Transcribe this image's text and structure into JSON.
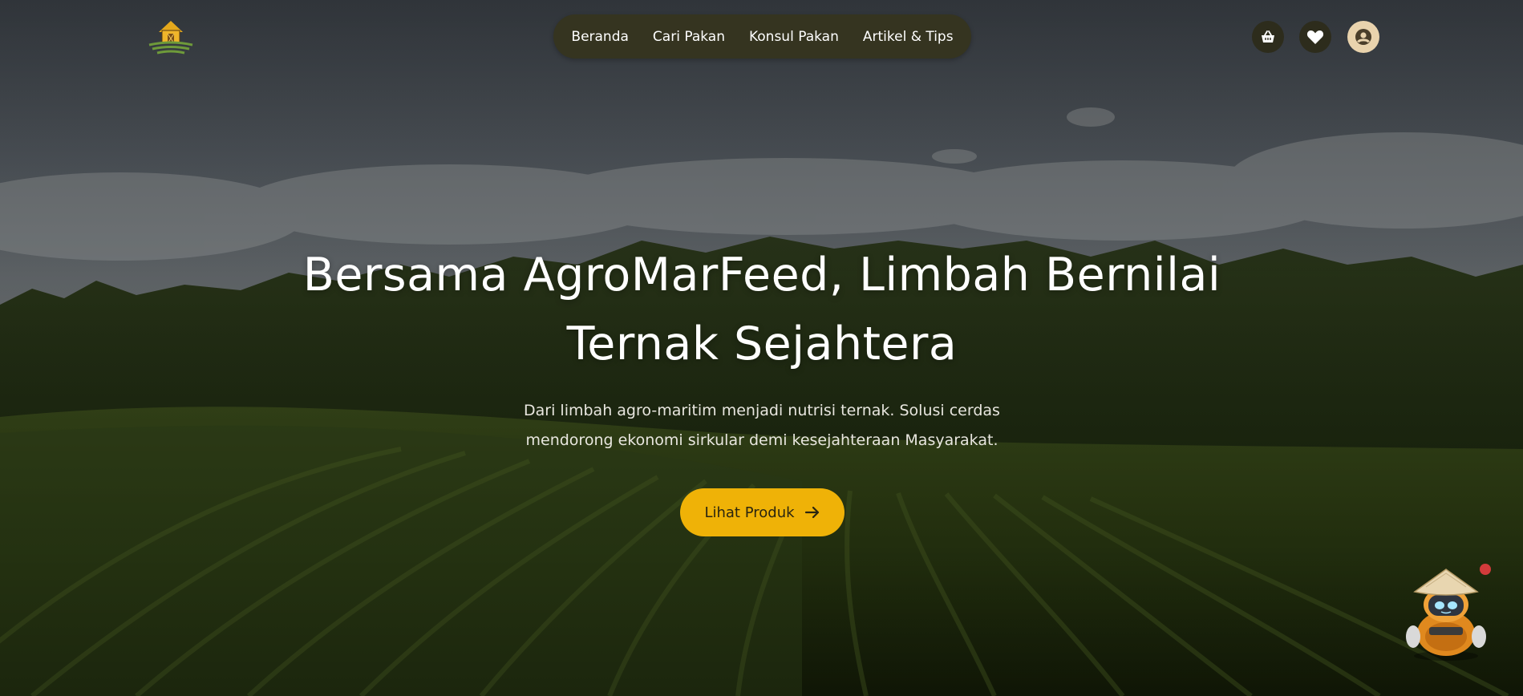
{
  "nav": {
    "links": [
      {
        "label": "Beranda"
      },
      {
        "label": "Cari Pakan"
      },
      {
        "label": "Konsul Pakan"
      },
      {
        "label": "Artikel & Tips"
      }
    ]
  },
  "header_icons": [
    "basket-icon",
    "heart-icon",
    "user-icon"
  ],
  "hero": {
    "headline_line1": "Bersama AgroMarFeed, Limbah Bernilai",
    "headline_line2": "Ternak Sejahtera",
    "subtitle_line1": "Dari limbah agro-maritim menjadi nutrisi ternak. Solusi cerdas",
    "subtitle_line2": "mendorong ekonomi sirkular demi kesejahteraan Masyarakat.",
    "cta_label": "Lihat Produk"
  },
  "colors": {
    "nav_bg": "#353420",
    "cta_bg": "#efb207",
    "user_btn_bg": "#e9d3ad",
    "icon_btn_bg": "#2d2c1c"
  }
}
